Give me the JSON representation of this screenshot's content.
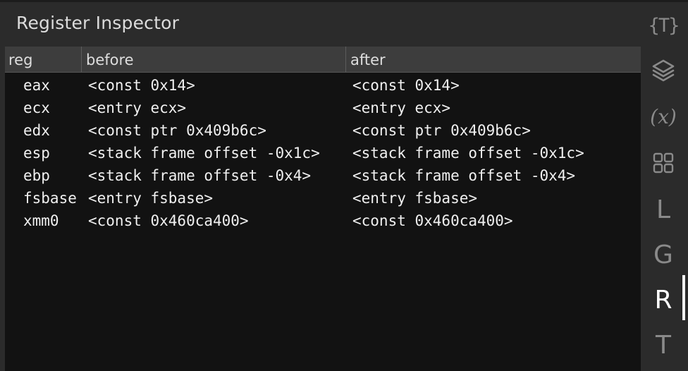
{
  "panel": {
    "title": "Register Inspector"
  },
  "table": {
    "columns": [
      "reg",
      "before",
      "after"
    ],
    "rows": [
      {
        "reg": "eax",
        "before": "<const 0x14>",
        "after": "<const 0x14>"
      },
      {
        "reg": "ecx",
        "before": "<entry ecx>",
        "after": "<entry ecx>"
      },
      {
        "reg": "edx",
        "before": "<const ptr 0x409b6c>",
        "after": "<const ptr 0x409b6c>"
      },
      {
        "reg": "esp",
        "before": "<stack frame offset -0x1c>",
        "after": "<stack frame offset -0x1c>"
      },
      {
        "reg": "ebp",
        "before": "<stack frame offset -0x4>",
        "after": "<stack frame offset -0x4>"
      },
      {
        "reg": "fsbase",
        "before": "<entry fsbase>",
        "after": "<entry fsbase>"
      },
      {
        "reg": "xmm0",
        "before": "<const 0x460ca400>",
        "after": "<const 0x460ca400>"
      }
    ]
  },
  "sidebar": {
    "items": [
      {
        "icon": "type-braces-icon",
        "glyph": "{T}",
        "active": false
      },
      {
        "icon": "layers-icon",
        "glyph": "",
        "active": false
      },
      {
        "icon": "variables-icon",
        "glyph": "(x)",
        "active": false
      },
      {
        "icon": "grid-icon",
        "glyph": "",
        "active": false
      },
      {
        "icon": "letter-l-icon",
        "glyph": "L",
        "active": false
      },
      {
        "icon": "letter-g-icon",
        "glyph": "G",
        "active": false
      },
      {
        "icon": "letter-r-icon",
        "glyph": "R",
        "active": true
      },
      {
        "icon": "letter-t-icon",
        "glyph": "T",
        "active": false
      }
    ]
  },
  "colors": {
    "background": "#2b2b2b",
    "table_background": "#121212",
    "header_background": "#3d3d3d",
    "icon_inactive": "#8a8a8a",
    "icon_active": "#ffffff"
  }
}
